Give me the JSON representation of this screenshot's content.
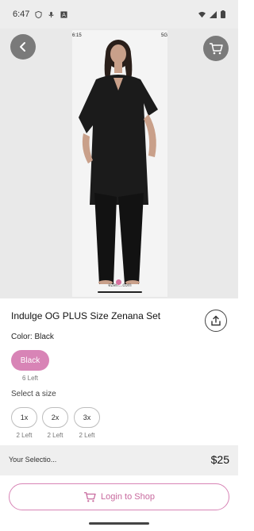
{
  "status_bar": {
    "time": "6:47",
    "icons": [
      "shield-icon",
      "mic-off-icon",
      "a-box-icon",
      "wifi-icon",
      "signal-icon",
      "battery-icon"
    ]
  },
  "product_photo": {
    "status_time": "6:15",
    "status_right": "5G",
    "url_text": "ezen...com"
  },
  "product": {
    "title": "Indulge OG PLUS Size Zenana Set",
    "color_label": "Color: Black",
    "color_option": "Black",
    "color_stock": "6 Left",
    "size_label": "Select a size",
    "sizes": [
      {
        "label": "1x",
        "stock": "2 Left"
      },
      {
        "label": "2x",
        "stock": "2 Left"
      },
      {
        "label": "3x",
        "stock": "2 Left"
      }
    ]
  },
  "selection": {
    "label": "Your Selectio...",
    "price": "$25"
  },
  "actions": {
    "login_label": "Login to Shop"
  },
  "colors": {
    "accent": "#d884b6",
    "accent_text": "#c86a9e",
    "button_gray": "#7a7a7a"
  }
}
